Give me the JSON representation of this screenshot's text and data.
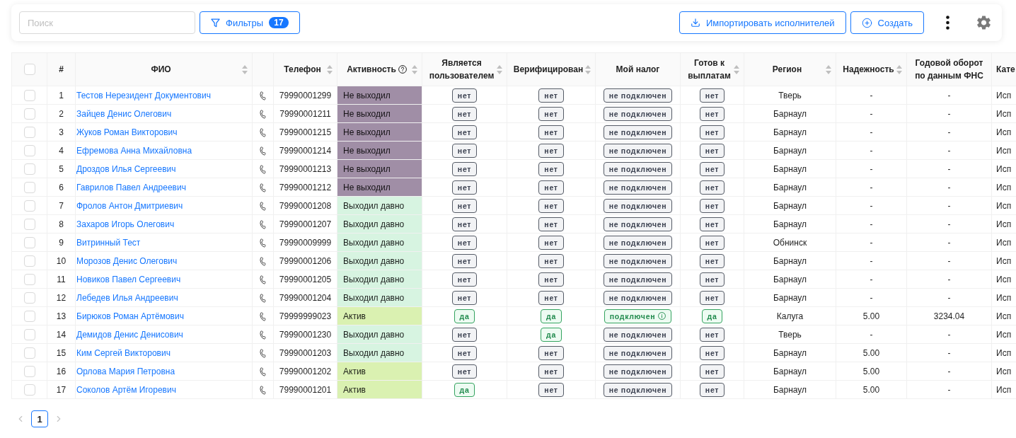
{
  "toolbar": {
    "search": {
      "placeholder": "Поиск"
    },
    "filter_button": {
      "label": "Фильтры",
      "count": "17"
    },
    "import_button": {
      "label": "Импортировать исполнителей"
    },
    "create_button": {
      "label": "Создать"
    }
  },
  "table": {
    "select_all": {
      "checked": false
    },
    "columns": [
      {
        "label": "#",
        "sortable": false,
        "help": false
      },
      {
        "label": "ФИО",
        "sortable": true,
        "help": false
      },
      {
        "label": "Телефон",
        "sortable": true,
        "help": false
      },
      {
        "label": "Активность",
        "sortable": true,
        "help": true
      },
      {
        "label": "Является пользователем",
        "sortable": true,
        "help": false
      },
      {
        "label": "Верифицирован",
        "sortable": true,
        "help": false
      },
      {
        "label": "Мой налог",
        "sortable": false,
        "help": false
      },
      {
        "label": "Готов к выплатам",
        "sortable": true,
        "help": false
      },
      {
        "label": "Регион",
        "sortable": true,
        "help": false
      },
      {
        "label": "Надежность",
        "sortable": true,
        "help": false
      },
      {
        "label": "Годовой оборот по данным ФНС",
        "sortable": false,
        "help": false
      },
      {
        "label": "Кате",
        "sortable": false,
        "help": false
      }
    ],
    "rows": [
      {
        "checked": false,
        "number": "1",
        "name": "Тестов Нерезидент Документович",
        "phone": "79990001299",
        "activity": {
          "label": "Не выходил",
          "color": "#a08ea6"
        },
        "is_user": {
          "label": "нет",
          "on": false
        },
        "verified": {
          "label": "нет",
          "on": false
        },
        "my_tax": {
          "label": "не подключен",
          "on": false
        },
        "ready": {
          "label": "нет",
          "on": false
        },
        "region": "Тверь",
        "reliability": "-",
        "turnover": "-",
        "category": "Исп"
      },
      {
        "checked": false,
        "number": "2",
        "name": "Зайцев Денис Олегович",
        "phone": "79990001211",
        "activity": {
          "label": "Не выходил",
          "color": "#a08ea6"
        },
        "is_user": {
          "label": "нет",
          "on": false
        },
        "verified": {
          "label": "нет",
          "on": false
        },
        "my_tax": {
          "label": "не подключен",
          "on": false
        },
        "ready": {
          "label": "нет",
          "on": false
        },
        "region": "Барнаул",
        "reliability": "-",
        "turnover": "-",
        "category": "Исп"
      },
      {
        "checked": false,
        "number": "3",
        "name": "Жуков Роман Викторович",
        "phone": "79990001215",
        "activity": {
          "label": "Не выходил",
          "color": "#a08ea6"
        },
        "is_user": {
          "label": "нет",
          "on": false
        },
        "verified": {
          "label": "нет",
          "on": false
        },
        "my_tax": {
          "label": "не подключен",
          "on": false
        },
        "ready": {
          "label": "нет",
          "on": false
        },
        "region": "Барнаул",
        "reliability": "-",
        "turnover": "-",
        "category": "Исп"
      },
      {
        "checked": false,
        "number": "4",
        "name": "Ефремова Анна Михайловна",
        "phone": "79990001214",
        "activity": {
          "label": "Не выходил",
          "color": "#a08ea6"
        },
        "is_user": {
          "label": "нет",
          "on": false
        },
        "verified": {
          "label": "нет",
          "on": false
        },
        "my_tax": {
          "label": "не подключен",
          "on": false
        },
        "ready": {
          "label": "нет",
          "on": false
        },
        "region": "Барнаул",
        "reliability": "-",
        "turnover": "-",
        "category": "Исп"
      },
      {
        "checked": false,
        "number": "5",
        "name": "Дроздов Илья Сергеевич",
        "phone": "79990001213",
        "activity": {
          "label": "Не выходил",
          "color": "#a08ea6"
        },
        "is_user": {
          "label": "нет",
          "on": false
        },
        "verified": {
          "label": "нет",
          "on": false
        },
        "my_tax": {
          "label": "не подключен",
          "on": false
        },
        "ready": {
          "label": "нет",
          "on": false
        },
        "region": "Барнаул",
        "reliability": "-",
        "turnover": "-",
        "category": "Исп"
      },
      {
        "checked": false,
        "number": "6",
        "name": "Гаврилов Павел Андреевич",
        "phone": "79990001212",
        "activity": {
          "label": "Не выходил",
          "color": "#a08ea6"
        },
        "is_user": {
          "label": "нет",
          "on": false
        },
        "verified": {
          "label": "нет",
          "on": false
        },
        "my_tax": {
          "label": "не подключен",
          "on": false
        },
        "ready": {
          "label": "нет",
          "on": false
        },
        "region": "Барнаул",
        "reliability": "-",
        "turnover": "-",
        "category": "Исп"
      },
      {
        "checked": false,
        "number": "7",
        "name": "Фролов Антон Дмитриевич",
        "phone": "79990001208",
        "activity": {
          "label": "Выходил давно",
          "color": "#d7f4e1"
        },
        "is_user": {
          "label": "нет",
          "on": false
        },
        "verified": {
          "label": "нет",
          "on": false
        },
        "my_tax": {
          "label": "не подключен",
          "on": false
        },
        "ready": {
          "label": "нет",
          "on": false
        },
        "region": "Барнаул",
        "reliability": "-",
        "turnover": "-",
        "category": "Исп"
      },
      {
        "checked": false,
        "number": "8",
        "name": "Захаров Игорь Олегович",
        "phone": "79990001207",
        "activity": {
          "label": "Выходил давно",
          "color": "#d7f4e1"
        },
        "is_user": {
          "label": "нет",
          "on": false
        },
        "verified": {
          "label": "нет",
          "on": false
        },
        "my_tax": {
          "label": "не подключен",
          "on": false
        },
        "ready": {
          "label": "нет",
          "on": false
        },
        "region": "Барнаул",
        "reliability": "-",
        "turnover": "-",
        "category": "Исп"
      },
      {
        "checked": false,
        "number": "9",
        "name": "Витринный Тест",
        "phone": "79990009999",
        "activity": {
          "label": "Выходил давно",
          "color": "#d7f4e1"
        },
        "is_user": {
          "label": "нет",
          "on": false
        },
        "verified": {
          "label": "нет",
          "on": false
        },
        "my_tax": {
          "label": "не подключен",
          "on": false
        },
        "ready": {
          "label": "нет",
          "on": false
        },
        "region": "Обнинск",
        "reliability": "-",
        "turnover": "-",
        "category": "Исп"
      },
      {
        "checked": false,
        "number": "10",
        "name": "Морозов Денис Олегович",
        "phone": "79990001206",
        "activity": {
          "label": "Выходил давно",
          "color": "#d7f4e1"
        },
        "is_user": {
          "label": "нет",
          "on": false
        },
        "verified": {
          "label": "нет",
          "on": false
        },
        "my_tax": {
          "label": "не подключен",
          "on": false
        },
        "ready": {
          "label": "нет",
          "on": false
        },
        "region": "Барнаул",
        "reliability": "-",
        "turnover": "-",
        "category": "Исп"
      },
      {
        "checked": false,
        "number": "11",
        "name": "Новиков Павел Сергеевич",
        "phone": "79990001205",
        "activity": {
          "label": "Выходил давно",
          "color": "#d7f4e1"
        },
        "is_user": {
          "label": "нет",
          "on": false
        },
        "verified": {
          "label": "нет",
          "on": false
        },
        "my_tax": {
          "label": "не подключен",
          "on": false
        },
        "ready": {
          "label": "нет",
          "on": false
        },
        "region": "Барнаул",
        "reliability": "-",
        "turnover": "-",
        "category": "Исп"
      },
      {
        "checked": false,
        "number": "12",
        "name": "Лебедев Илья Андреевич",
        "phone": "79990001204",
        "activity": {
          "label": "Выходил давно",
          "color": "#d7f4e1"
        },
        "is_user": {
          "label": "нет",
          "on": false
        },
        "verified": {
          "label": "нет",
          "on": false
        },
        "my_tax": {
          "label": "не подключен",
          "on": false
        },
        "ready": {
          "label": "нет",
          "on": false
        },
        "region": "Барнаул",
        "reliability": "-",
        "turnover": "-",
        "category": "Исп"
      },
      {
        "checked": false,
        "number": "13",
        "name": "Бирюков Роман Артёмович",
        "phone": "79999999023",
        "activity": {
          "label": "Актив",
          "color": "#daf1b1"
        },
        "is_user": {
          "label": "да",
          "on": true
        },
        "verified": {
          "label": "да",
          "on": true
        },
        "my_tax": {
          "label": "подключен",
          "on": true
        },
        "ready": {
          "label": "да",
          "on": true
        },
        "region": "Калуга",
        "reliability": "5.00",
        "turnover": "3234.04",
        "category": "Исп"
      },
      {
        "checked": false,
        "number": "14",
        "name": "Демидов Денис Денисович",
        "phone": "79990001230",
        "activity": {
          "label": "Выходил давно",
          "color": "#d7f4e1"
        },
        "is_user": {
          "label": "нет",
          "on": false
        },
        "verified": {
          "label": "да",
          "on": true
        },
        "my_tax": {
          "label": "не подключен",
          "on": false
        },
        "ready": {
          "label": "нет",
          "on": false
        },
        "region": "Тверь",
        "reliability": "-",
        "turnover": "-",
        "category": "Исп"
      },
      {
        "checked": false,
        "number": "15",
        "name": "Ким Сергей Викторович",
        "phone": "79990001203",
        "activity": {
          "label": "Выходил давно",
          "color": "#d7f4e1"
        },
        "is_user": {
          "label": "нет",
          "on": false
        },
        "verified": {
          "label": "нет",
          "on": false
        },
        "my_tax": {
          "label": "не подключен",
          "on": false
        },
        "ready": {
          "label": "нет",
          "on": false
        },
        "region": "Барнаул",
        "reliability": "5.00",
        "turnover": "-",
        "category": "Исп"
      },
      {
        "checked": false,
        "number": "16",
        "name": "Орлова Мария Петровна",
        "phone": "79990001202",
        "activity": {
          "label": "Актив",
          "color": "#daf1b1"
        },
        "is_user": {
          "label": "нет",
          "on": false
        },
        "verified": {
          "label": "нет",
          "on": false
        },
        "my_tax": {
          "label": "не подключен",
          "on": false
        },
        "ready": {
          "label": "нет",
          "on": false
        },
        "region": "Барнаул",
        "reliability": "5.00",
        "turnover": "-",
        "category": "Исп"
      },
      {
        "checked": false,
        "number": "17",
        "name": "Соколов Артём Игоревич",
        "phone": "79990001201",
        "activity": {
          "label": "Актив",
          "color": "#daf1b1"
        },
        "is_user": {
          "label": "да",
          "on": true
        },
        "verified": {
          "label": "нет",
          "on": false
        },
        "my_tax": {
          "label": "не подключен",
          "on": false
        },
        "ready": {
          "label": "нет",
          "on": false
        },
        "region": "Барнаул",
        "reliability": "5.00",
        "turnover": "-",
        "category": "Исп"
      }
    ]
  },
  "pagination": {
    "prev": {
      "disabled": true
    },
    "pages": [
      {
        "label": "1",
        "selected": true
      }
    ],
    "next": {
      "disabled": true
    }
  }
}
